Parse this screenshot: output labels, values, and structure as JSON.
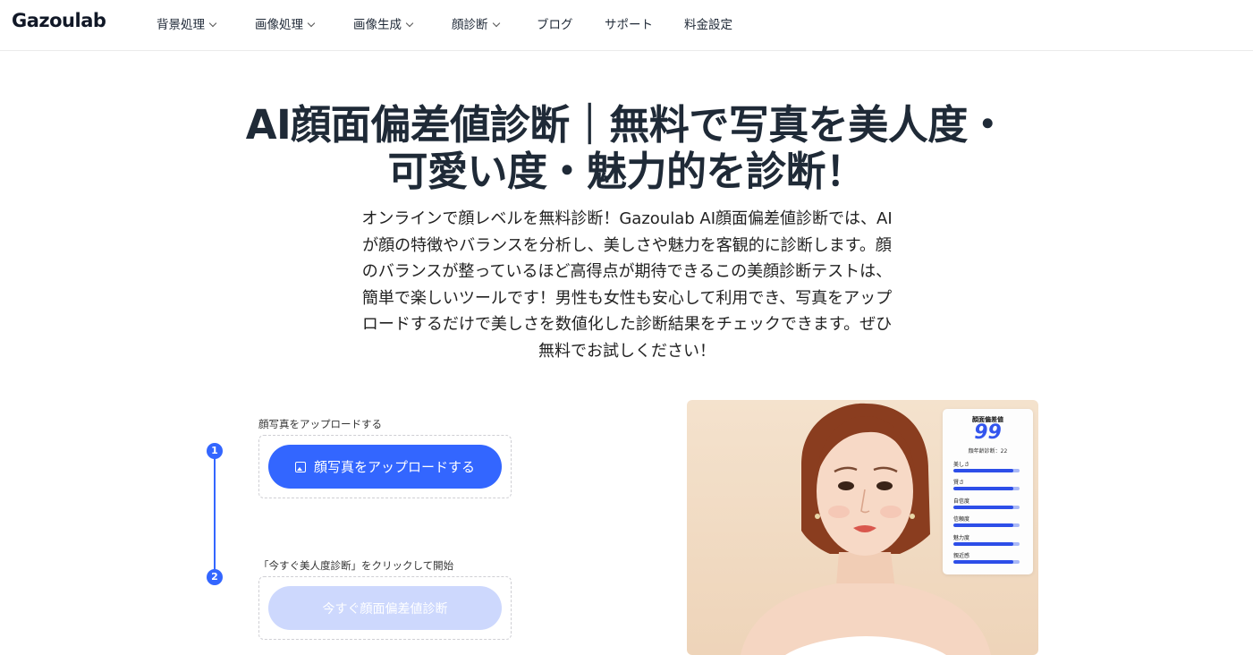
{
  "header": {
    "logo": "Gazoulab",
    "nav": [
      {
        "label": "背景処理",
        "dropdown": true
      },
      {
        "label": "画像処理",
        "dropdown": true
      },
      {
        "label": "画像生成",
        "dropdown": true
      },
      {
        "label": "顔診断",
        "dropdown": true
      },
      {
        "label": "ブログ",
        "dropdown": false
      },
      {
        "label": "サポート",
        "dropdown": false
      },
      {
        "label": "料金設定",
        "dropdown": false
      }
    ]
  },
  "hero": {
    "title_line1": "AI顔面偏差値診断｜無料で写真を美人度・",
    "title_line2": "可愛い度・魅力的を診断！",
    "description_lines": [
      "オンラインで顔レベルを無料診断！Gazoulab AI顔面偏差値診断では、AI",
      "が顔の特徴やバランスを分析し、美しさや魅力を客観的に診断します。顔",
      "のバランスが整っているほど高得点が期待できるこの美顔診断テストは、",
      "簡単で楽しいツールです！男性も女性も安心して利用でき、写真をアップ",
      "ロードするだけで美しさを数値化した診断結果をチェックできます。ぜひ",
      "無料でお試しください！"
    ]
  },
  "steps": [
    {
      "number": "1",
      "label": "顔写真をアップロードする",
      "button": "顔写真をアップロードする",
      "button_icon": "image-icon"
    },
    {
      "number": "2",
      "label": "「今すぐ美人度診断」をクリックして開始",
      "button": "今すぐ顔面偏差値診断"
    }
  ],
  "preview": {
    "card_title": "顔面偏差値",
    "score": "99",
    "age_text": "顔年齢診断：22",
    "metrics": [
      {
        "label": "美しさ",
        "value": 0.9
      },
      {
        "label": "賢さ",
        "value": 0.9
      },
      {
        "label": "自信度",
        "value": 0.9
      },
      {
        "label": "信頼度",
        "value": 0.9
      },
      {
        "label": "魅力度",
        "value": 0.9
      },
      {
        "label": "親近感",
        "value": 0.9
      }
    ]
  },
  "colors": {
    "accent": "#3366ff",
    "disabled_button": "#cdd8fd",
    "score": "#3355ee"
  }
}
